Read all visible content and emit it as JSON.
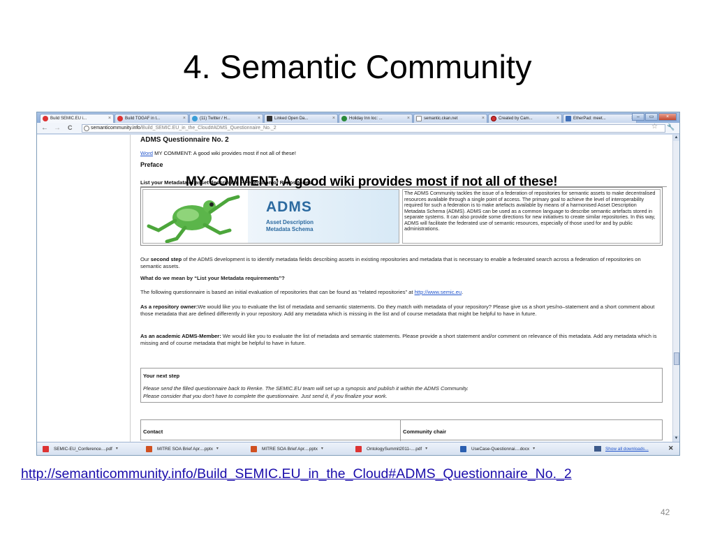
{
  "slide": {
    "title": "4. Semantic Community",
    "url": "http://semanticommunity.info/Build_SEMIC.EU_in_the_Cloud#ADMS_Questionnaire_No._2",
    "page_number": "42"
  },
  "browser": {
    "tabs": [
      {
        "label": "Build SEMIC.EU i...",
        "icon": "page-icon"
      },
      {
        "label": "Build TOGAF in t...",
        "icon": "page-icon"
      },
      {
        "label": "(11) Twitter / H...",
        "icon": "twitter-icon"
      },
      {
        "label": "Linked Open Da...",
        "icon": "info-icon"
      },
      {
        "label": "Holiday Inn loc: ...",
        "icon": "page-icon"
      },
      {
        "label": "semantic.ckan.net",
        "icon": "page-icon"
      },
      {
        "label": "Created by Cam...",
        "icon": "page-icon"
      },
      {
        "label": "EtherPad: meet...",
        "icon": "page-icon"
      }
    ],
    "address": {
      "host": "semanticommunity.info",
      "path": "/Build_SEMIC.EU_in_the_Cloud#ADMS_Questionnaire_No._2"
    },
    "page": {
      "heading": "ADMS Questionnaire No. 2",
      "word_link": "Word",
      "word_comment": "MY COMMENT: A good wiki provides most if not all of these!",
      "preface": "Preface",
      "overlay_comment": "MY COMMENT: A good wiki provides most if not all of these!",
      "list_heading": "List your Metadata of asset description – Federation of Repositories",
      "logo": {
        "title": "ADMS",
        "subtitle_line1": "Asset Description",
        "subtitle_line2": "Metadata Schema"
      },
      "adms_description": "The ADMS Community tackles the issue of a federation of repositories for semantic assets to make decentralised resources available through a single point of access. The primary goal to achieve the level of interoperability required for such a federation is to make artefacts available by means of a harmonised Asset Description Metadata Schema (ADMS). ADMS can be used as a common language to describe semantic artefacts stored in separate systems. It can also provide some directions for new initiatives to create similar repositories. In this way, ADMS will facilitate the federated use of semantic resources, especially of those used for and by public administrations.",
      "second_step": {
        "prefix": "Our ",
        "bold": "second step",
        "rest": " of the ADMS development is to identify metadata fields describing assets in existing repositories and metadata that is necessary to enable a federated search across a federation of repositories on semantic assets."
      },
      "what_mean": "What do we mean by “List your Metadata requirements”?",
      "questionnaire": {
        "text": "The following questionnaire is based an initial evaluation of repositories that can be found as “related repositories” at ",
        "link": "http://www.semic.eu"
      },
      "repo_owner": {
        "bold": "As a repository owner:",
        "text": "We would like you to evaluate the list of metadata and semantic statements. Do they match with metadata of your repository? Please give us a short yes/no–statement and a short comment about those metadata that are defined differently in your repository. Add any metadata which is missing in the list and of course metadata that might be helpful to have in future."
      },
      "academic": {
        "bold": "As an academic ADMS-Member:",
        "text": " We would like you to evaluate the list of metadata and semantic statements. Please provide a short statement and/or comment on relevance of this metadata. Add any metadata which is missing and of course metadata that might be helpful to have in future."
      },
      "next_step": {
        "title": "Your next step",
        "line1": "Please send the filled questionnaire back to Renke. The SEMIC.EU team will set up a synopsis and publish it within the ADMS Community.",
        "line2": "Please consider that you don't have to complete the questionnaire. Just send it, if you finalize your work."
      },
      "contact": "Contact",
      "community_chair": "Community chair"
    },
    "downloads": [
      {
        "label": "SEMIC-EU_Conference....pdf",
        "icon": "pdf-icon"
      },
      {
        "label": "MITRE SOA Brief Apr....pptx",
        "icon": "pptx-icon"
      },
      {
        "label": "MITRE SOA Brief Apr....pptx",
        "icon": "pptx-icon"
      },
      {
        "label": "OntologySummit2011-....pdf",
        "icon": "pdf-icon"
      },
      {
        "label": "UseCase-Questionnai....docx",
        "icon": "docx-icon"
      }
    ],
    "show_all_downloads": "Show all downloads..."
  }
}
